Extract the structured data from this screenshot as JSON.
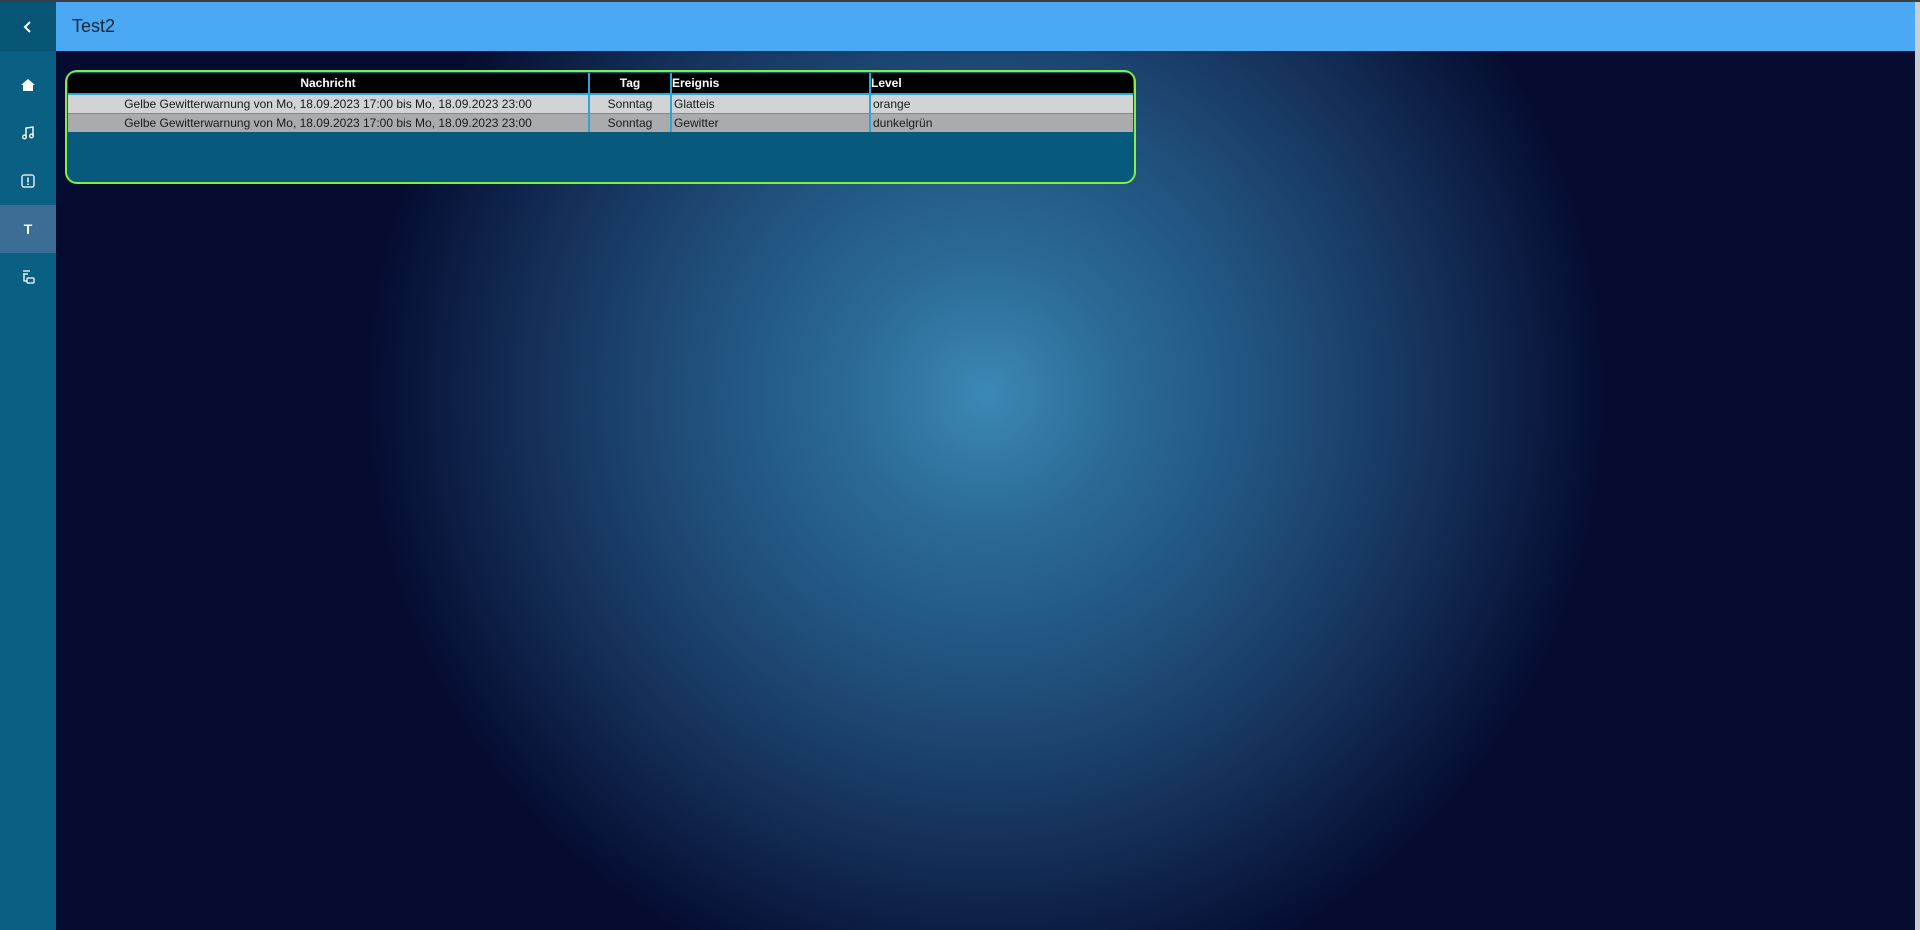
{
  "header": {
    "title": "Test2"
  },
  "sidebar": {
    "back_icon": "chevron-left-icon",
    "items": [
      {
        "icon": "home-icon",
        "active": false
      },
      {
        "icon": "music-note-icon",
        "active": false
      },
      {
        "icon": "alert-square-icon",
        "active": false
      },
      {
        "icon": "t-letter-icon",
        "label": "T",
        "active": true
      },
      {
        "icon": "list-flow-icon",
        "active": false
      }
    ]
  },
  "table": {
    "columns": [
      "Nachricht",
      "Tag",
      "Ereignis",
      "Level"
    ],
    "rows": [
      {
        "nachricht": "Gelbe Gewitterwarnung von Mo, 18.09.2023 17:00 bis Mo, 18.09.2023 23:00",
        "tag": "Sonntag",
        "ereignis": "Glatteis",
        "level": "orange"
      },
      {
        "nachricht": "Gelbe Gewitterwarnung von Mo, 18.09.2023 17:00 bis Mo, 18.09.2023 23:00",
        "tag": "Sonntag",
        "ereignis": "Gewitter",
        "level": "dunkelgrün"
      }
    ]
  },
  "colors": {
    "header": "#4aa9f2",
    "sidebar": "#0a6082",
    "sidebar_active": "#3b6d95",
    "widget_border": "#83ef3f",
    "table_divider": "#2aa6d9"
  }
}
